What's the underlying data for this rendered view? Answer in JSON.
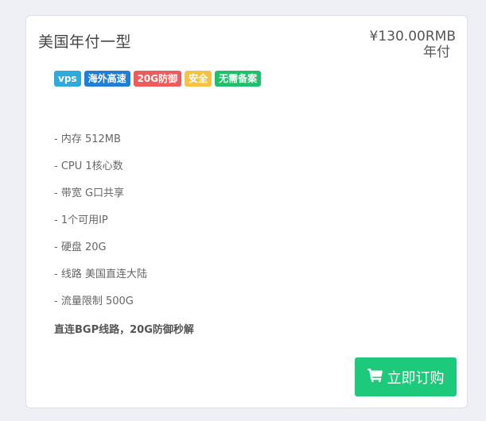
{
  "product": {
    "name": "美国年付一型",
    "price": "¥130.00RMB",
    "period": "年付"
  },
  "tags": [
    {
      "label": "vps",
      "color": "#2eaadc"
    },
    {
      "label": "海外高速",
      "color": "#1f7fd6"
    },
    {
      "label": "20G防御",
      "color": "#ef5a5a"
    },
    {
      "label": "安全",
      "color": "#f5c243"
    },
    {
      "label": "无需备案",
      "color": "#1fbf6b"
    }
  ],
  "features": [
    "- 内存 512MB",
    "- CPU 1核心数",
    "- 带宽 G口共享",
    "- 1个可用IP",
    "- 硬盘 20G",
    "- 线路 美国直连大陆",
    "- 流量限制 500G"
  ],
  "highlight": "直连BGP线路，20G防御秒解",
  "buy_button": {
    "label": "立即订购",
    "icon": "cart-icon",
    "color": "#1dc97b"
  }
}
